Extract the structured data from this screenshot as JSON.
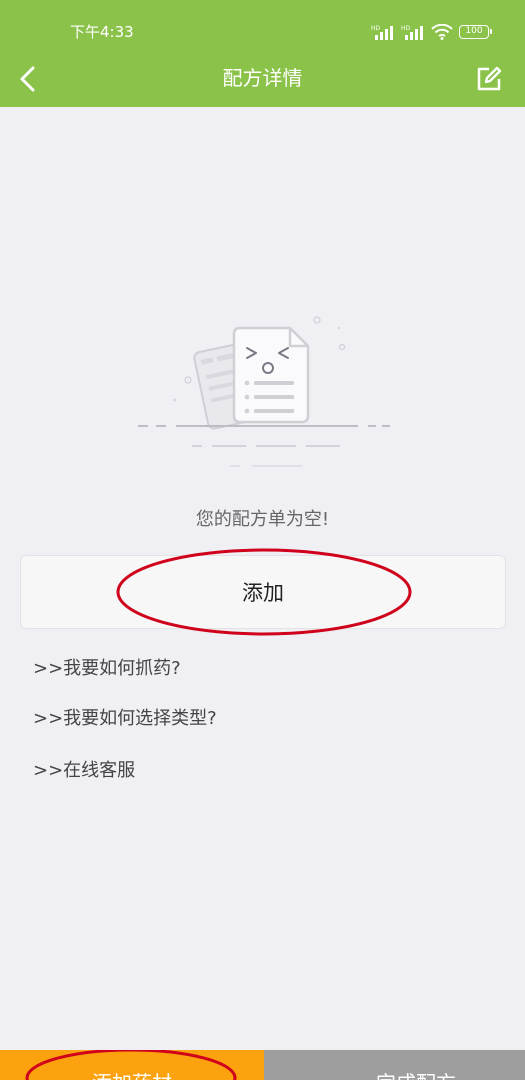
{
  "status_bar": {
    "time": "下午4:33",
    "battery": "100",
    "signal_label": "HD",
    "icons": [
      "hd-signal-icon",
      "hd-signal-icon",
      "wifi-icon",
      "battery-icon"
    ]
  },
  "nav": {
    "title": "配方详情",
    "back_icon": "chevron-left-icon",
    "edit_icon": "edit-icon"
  },
  "empty_state": {
    "illustration": "empty-document-icon",
    "message": "您的配方单为空!"
  },
  "add_button": {
    "label": "添加"
  },
  "help_links": [
    ">>我要如何抓药?",
    ">>我要如何选择类型?",
    ">>在线客服"
  ],
  "bottom_bar": {
    "left_label": "添加药材",
    "right_label": "完成配方"
  },
  "colors": {
    "header": "#8bc34a",
    "background": "#f0eff4",
    "bottom_left": "#fda20f",
    "bottom_right": "#9e9e9e",
    "annotation": "#d0021b"
  }
}
